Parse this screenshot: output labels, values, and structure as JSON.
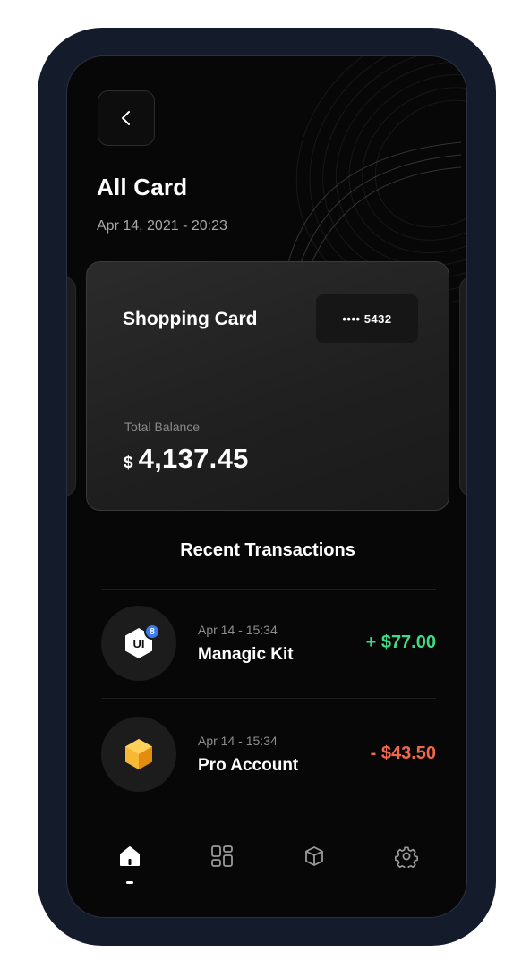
{
  "header": {
    "title": "All Card",
    "date": "Apr 14, 2021 - 20:23"
  },
  "card": {
    "title": "Shopping Card",
    "number_masked": "•••• 5432",
    "balance_label": "Total Balance",
    "currency": "$",
    "balance": "4,137.45"
  },
  "transactions": {
    "section_title": "Recent Transactions",
    "items": [
      {
        "date": "Apr 14 - 15:34",
        "name": "Managic Kit",
        "amount": "+ $77.00",
        "amount_color": "#3ddc84",
        "icon": "ui-kit-hexagon-icon",
        "icon_text": "UI",
        "badge": "8"
      },
      {
        "date": "Apr 14 - 15:34",
        "name": "Pro Account",
        "amount": "- $43.50",
        "amount_color": "#f2674a",
        "icon": "gold-gem-icon"
      }
    ]
  },
  "nav": {
    "items": [
      {
        "icon": "home-icon",
        "active": true
      },
      {
        "icon": "grid-icon",
        "active": false
      },
      {
        "icon": "box-icon",
        "active": false
      },
      {
        "icon": "settings-icon",
        "active": false
      }
    ]
  },
  "colors": {
    "frame": "#141b2b",
    "screen_bg": "#070707",
    "positive": "#3ddc84",
    "negative": "#f2674a",
    "badge": "#3a7bf5"
  }
}
